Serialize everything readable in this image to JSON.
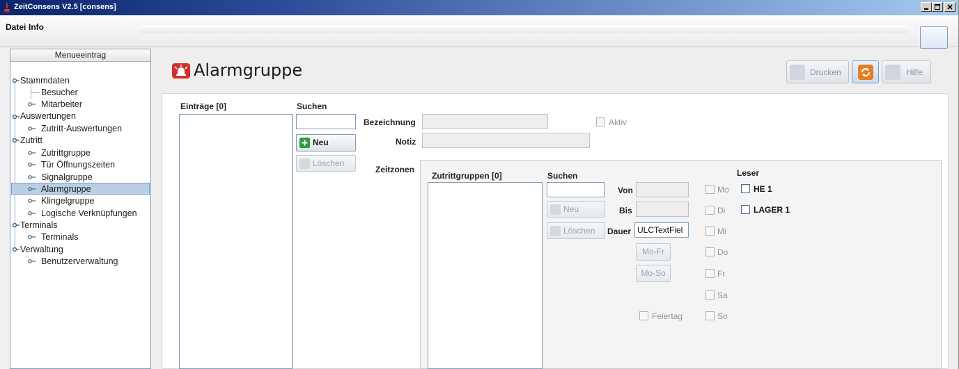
{
  "window": {
    "title": "ZeitConsens V2.5 [consens]"
  },
  "menubar": {
    "items": [
      "Datei",
      "Info"
    ]
  },
  "tree": {
    "header": "Menueeintrag",
    "items": [
      {
        "label": "Stammdaten"
      },
      {
        "label": "Besucher"
      },
      {
        "label": "Mitarbeiter"
      },
      {
        "label": "Auswertungen"
      },
      {
        "label": "Zutritt-Auswertungen"
      },
      {
        "label": "Zutritt"
      },
      {
        "label": "Zutrittgruppe"
      },
      {
        "label": "Tür Öffnungszeiten"
      },
      {
        "label": "Signalgruppe"
      },
      {
        "label": "Alarmgruppe",
        "selected": true
      },
      {
        "label": "Klingelgruppe"
      },
      {
        "label": "Logische Verknüpfungen"
      },
      {
        "label": "Terminals"
      },
      {
        "label": "Terminals"
      },
      {
        "label": "Verwaltung"
      },
      {
        "label": "Benutzerverwaltung"
      }
    ]
  },
  "page": {
    "title": "Alarmgruppe",
    "icon": "alarm-icon"
  },
  "toolbar": {
    "print_label": "Drucken",
    "refresh_icon": "refresh-icon",
    "help_label": "Hilfe"
  },
  "entries": {
    "header": "Einträge [0]",
    "search_label": "Suchen",
    "search_value": "",
    "new_label": "Neu",
    "delete_label": "Löschen"
  },
  "form": {
    "bezeichnung_label": "Bezeichnung",
    "bezeichnung_value": "",
    "aktiv_label": "Aktiv",
    "notiz_label": "Notiz",
    "notiz_value": "",
    "zeitzonen_label": "Zeitzonen"
  },
  "zeitzonen": {
    "groups_header": "Zutrittgruppen [0]",
    "search_label": "Suchen",
    "search_value": "",
    "new_label": "Neu",
    "delete_label": "Löschen",
    "von_label": "Von",
    "von_value": "",
    "bis_label": "Bis",
    "bis_value": "",
    "dauer_label": "Dauer",
    "dauer_value": "ULCTextFiel",
    "mofr_label": "Mo-Fr",
    "moso_label": "Mo-So",
    "feiertag_label": "Feiertag",
    "days": [
      "Mo",
      "Di",
      "Mi",
      "Do",
      "Fr",
      "Sa",
      "So"
    ]
  },
  "leser": {
    "header": "Leser",
    "items": [
      "HE 1",
      "LAGER 1"
    ]
  },
  "colors": {
    "accent": "#0a246a",
    "selection": "#b8cfe5",
    "new_icon": "#2e9a3c",
    "refresh_icon": "#e67e22",
    "alarm_icon": "#d0312d"
  }
}
